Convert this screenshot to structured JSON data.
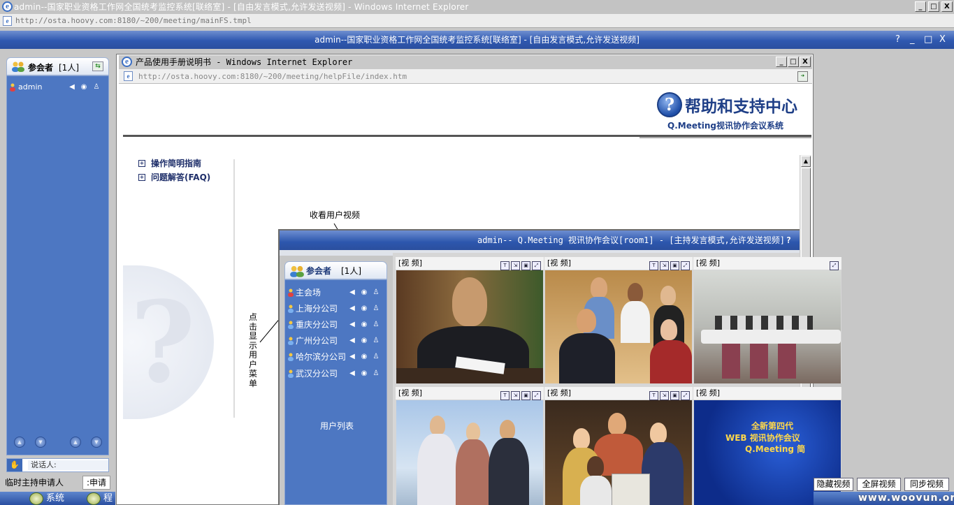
{
  "outer_window": {
    "title": "admin--国家职业资格工作网全国统考监控系统[联络室] - [自由发言模式,允许发送视频] - Windows Internet Explorer",
    "url": "http://osta.hoovy.com:8180/~200/meeting/mainFS.tmpl",
    "buttons": {
      "minimize": "_",
      "maximize": "□",
      "close": "X"
    }
  },
  "app": {
    "title": "admin--国家职业资格工作网全国统考监控系统[联络室] - [自由发言模式,允许发送视频]",
    "controls": {
      "help": "?",
      "minimize": "_",
      "maximize": "□",
      "close": "X"
    }
  },
  "participants": {
    "title": "参会者",
    "count": "[1人]",
    "users": [
      {
        "name": "admin"
      }
    ],
    "speaker_label": "说话人:",
    "temp_host_label": "临时主持申请人",
    "apply_button": ":申请"
  },
  "taskbar": {
    "items": [
      "系统",
      "程"
    ]
  },
  "help_window": {
    "title": "产品使用手册说明书 - Windows Internet Explorer",
    "url": "http://osta.hoovy.com:8180/~200/meeting/helpFile/index.htm",
    "header_title": "帮助和支持中心",
    "header_subtitle": "Q.Meeting视讯协作会议系统",
    "toc": [
      {
        "label": "操作简明指南"
      },
      {
        "label": "问题解答(FAQ)"
      }
    ],
    "annotation_top": "收看用户视频",
    "annotation_side": "点击显示用户菜单"
  },
  "screenshot": {
    "title": "admin-- Q.Meeting 视讯协作会议[room1] - [主持发言模式,允许发送视频]",
    "help": "?",
    "panel_title": "参会者",
    "panel_count": "[1人]",
    "users": [
      {
        "name": "主会场"
      },
      {
        "name": "上海分公司"
      },
      {
        "name": "重庆分公司"
      },
      {
        "name": "广州分公司"
      },
      {
        "name": "哈尔滨分公司"
      },
      {
        "name": "武汉分公司"
      }
    ],
    "user_list_label": "用户列表",
    "video_label": "[视 频]",
    "promo": {
      "line1": "全新第四代",
      "line2": "WEB 视讯协作会议",
      "line3": "Q.Meeting 简"
    }
  },
  "right_buttons": {
    "hide_video": "隐藏视频",
    "fullscreen_video": "全屏视频",
    "sync_video": "同步视频"
  },
  "watermark_url": "www.woovun.org"
}
